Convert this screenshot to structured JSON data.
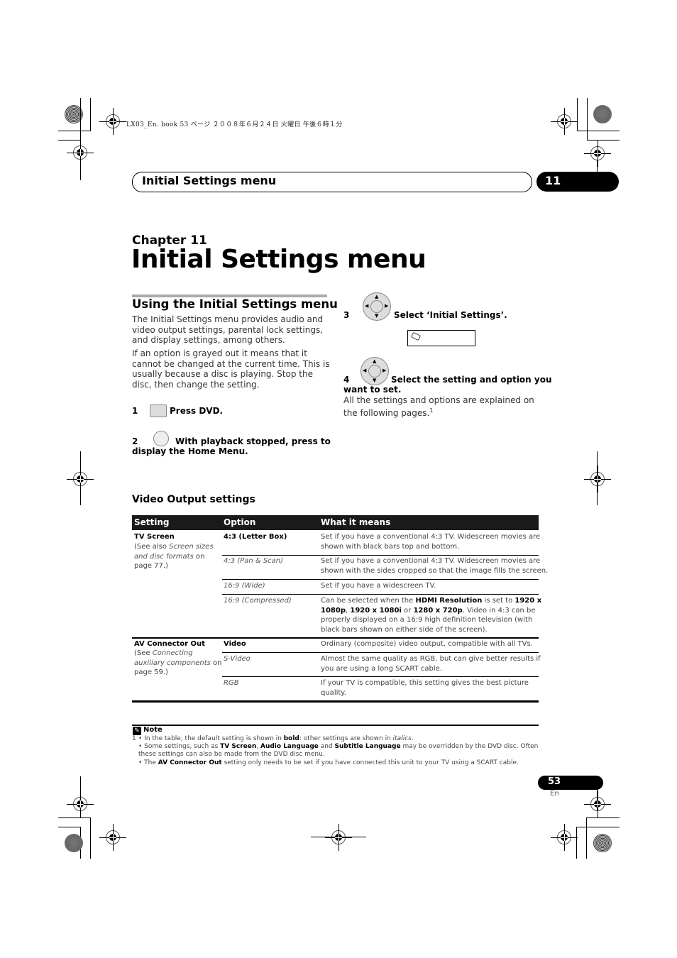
{
  "print_header": {
    "text": "LX03_En. book   53 ページ   ２００８年６月２４日   火曜日   午後６時１分"
  },
  "running_header": {
    "title": "Initial Settings menu",
    "chapter_number": "11"
  },
  "chapter": {
    "label": "Chapter 11",
    "title": "Initial Settings menu"
  },
  "section": {
    "title": "Using the Initial Settings menu",
    "paragraphs": [
      [
        "The Initial Settings menu provides audio and",
        "video output settings, parental lock settings,",
        "and display settings, among others."
      ],
      [
        "If an option is grayed out it means that it",
        "cannot be changed at the current time. This is",
        "usually because a disc is playing. Stop the",
        "disc, then change the setting."
      ]
    ]
  },
  "steps": [
    {
      "number": "1",
      "icon": "dvd-button-icon",
      "text": "Press DVD."
    },
    {
      "number": "2",
      "icon": "home-menu-button-icon",
      "text_line1": "With playback stopped, press to",
      "text_line2": "display the Home Menu."
    },
    {
      "number": "3",
      "icon": "dpad-icon",
      "text": "Select ‘Initial Settings’.",
      "screen_icon": "settings-icon"
    },
    {
      "number": "4",
      "icon": "dpad-icon",
      "text_line1": "Select the setting and option you",
      "text_line2": "want to set.",
      "body_line1": "All the settings and options are explained on",
      "body_line2": "the following pages.",
      "footnote_ref": "1"
    }
  ],
  "video_output": {
    "title": "Video Output settings",
    "columns": [
      "Setting",
      "Option",
      "What it means"
    ],
    "rows": [
      {
        "setting": "TV Screen",
        "setting_note": [
          "(See also ",
          "Screen sizes",
          "and disc formats",
          " on",
          "page 77.)"
        ],
        "options": [
          {
            "option": "4:3 (Letter Box)",
            "default": true,
            "meaning": [
              "Set if you have a conventional 4:3 TV. Widescreen movies are",
              "shown with black bars top and bottom."
            ]
          },
          {
            "option": "4:3 (Pan & Scan)",
            "default": false,
            "meaning": [
              "Set if you have a conventional 4:3 TV. Widescreen movies are",
              "shown with the sides cropped so that the image fills the screen."
            ]
          },
          {
            "option": "16:9 (Wide)",
            "default": false,
            "meaning": [
              "Set if you have a widescreen TV."
            ]
          },
          {
            "option": "16:9 (Compressed)",
            "default": false,
            "meaning_parts": {
              "a": "Can be selected when the ",
              "b": "HDMI Resolution",
              "c": " is set to ",
              "d": "1920 x",
              "e": "1080p",
              "f": ", ",
              "g": "1920 x 1080i",
              "h": " or ",
              "i": "1280 x 720p",
              "j": ". Video in 4:3 can be",
              "k": "properly displayed on a 16:9 high definition television (with",
              "l": "black bars shown on either side of the screen)."
            }
          }
        ]
      },
      {
        "setting": "AV Connector Out",
        "setting_note": [
          "(See ",
          "Connecting",
          "auxiliary components",
          " on",
          "page 59.)"
        ],
        "options": [
          {
            "option": "Video",
            "default": true,
            "meaning": [
              "Ordinary (composite) video output, compatible with all TVs."
            ]
          },
          {
            "option": "S-Video",
            "default": false,
            "meaning": [
              "Almost the same quality as RGB, but can give better results if",
              "you are using a long SCART cable."
            ]
          },
          {
            "option": "RGB",
            "default": false,
            "meaning": [
              "If your TV is compatible, this setting gives the best picture",
              "quality."
            ]
          }
        ]
      }
    ]
  },
  "note": {
    "title": "Note",
    "number": "1",
    "line1": {
      "a": "• In the table, the default setting is shown in ",
      "b": "bold",
      "c": ": other settings are shown in ",
      "d": "italics",
      "e": "."
    },
    "line2": {
      "a": "• Some settings, such as ",
      "b": "TV Screen",
      "c": ", ",
      "d": "Audio Language",
      "e": " and ",
      "f": "Subtitle Language",
      "g": " may be overridden by the DVD disc. Often"
    },
    "line3": "these settings can also be made from the DVD disc menu.",
    "line4": {
      "a": "• The ",
      "b": "AV Connector Out",
      "c": " setting only needs to be set if you have connected this unit to your TV using a SCART cable."
    }
  },
  "footer": {
    "page_number": "53",
    "language": "En"
  }
}
